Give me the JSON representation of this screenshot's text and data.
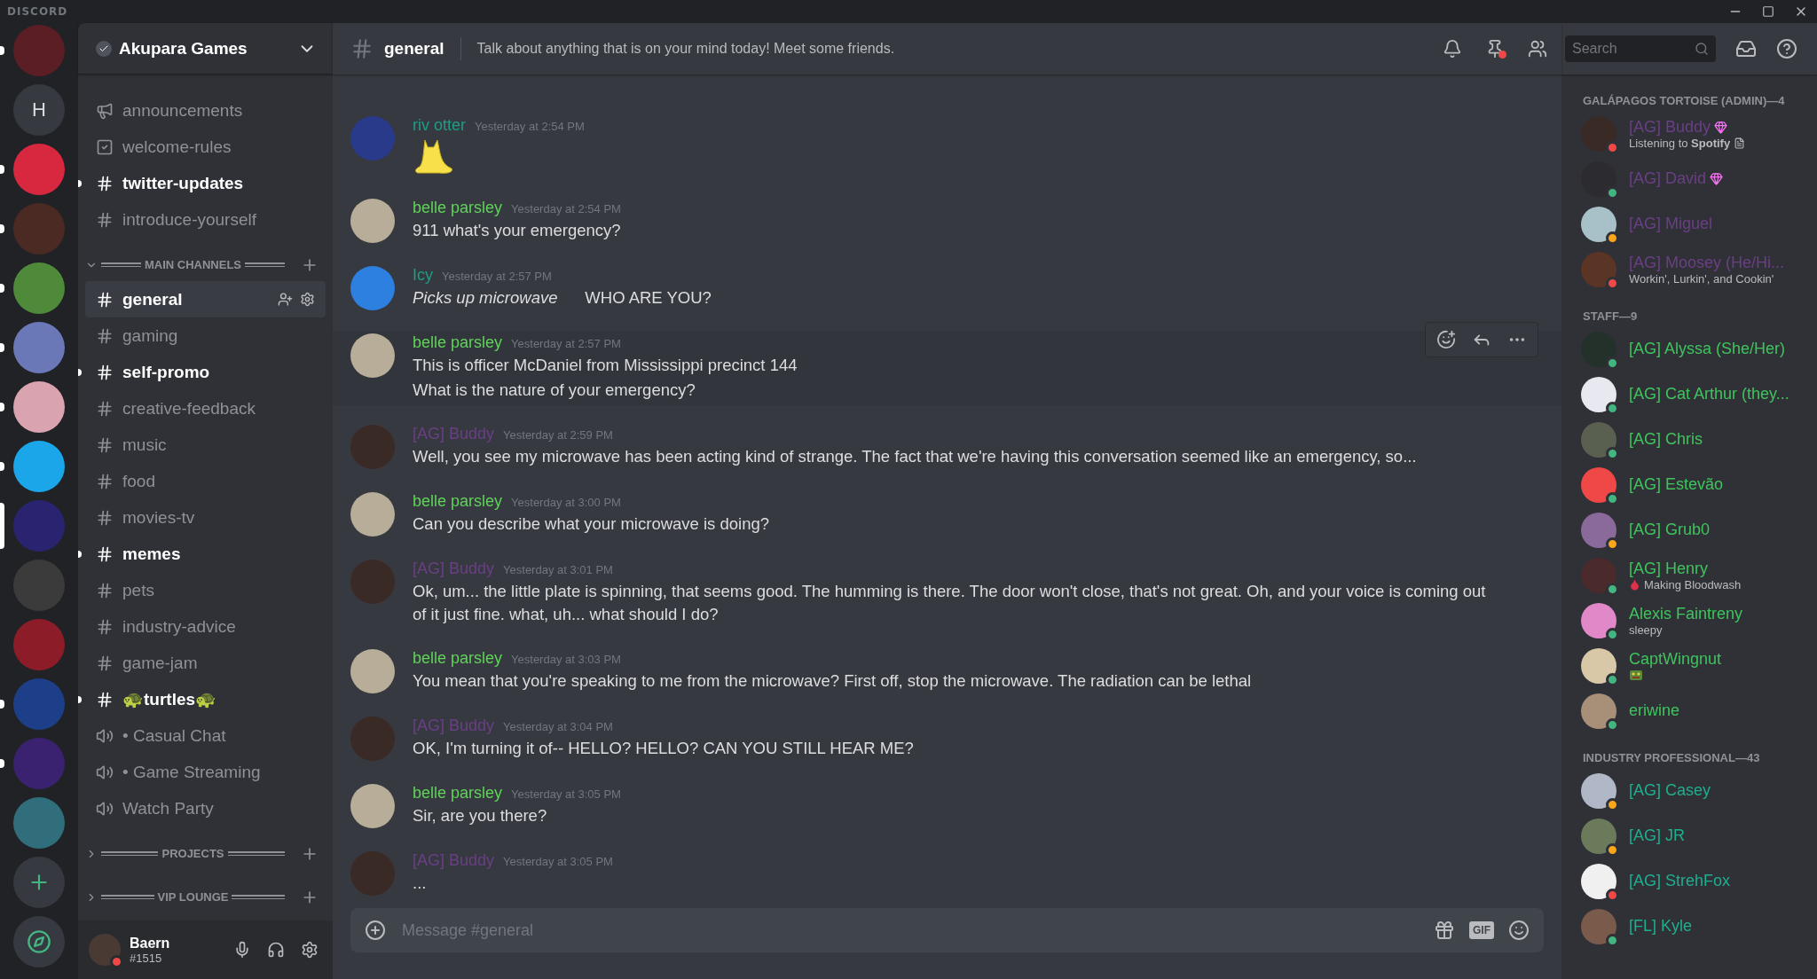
{
  "app": {
    "brand": "DISCORD"
  },
  "servers": [
    {
      "kind": "avatar",
      "color": "#5a1e24",
      "unread": true,
      "selected": false
    },
    {
      "kind": "letter",
      "label": "H",
      "unread": false,
      "selected": false
    },
    {
      "kind": "avatar",
      "color": "#d8283f",
      "unread": true,
      "selected": false
    },
    {
      "kind": "avatar",
      "color": "#4a2a22",
      "unread": true,
      "selected": false
    },
    {
      "kind": "avatar",
      "color": "#4f8a3a",
      "unread": true,
      "selected": false
    },
    {
      "kind": "avatar",
      "color": "#6a78b8",
      "unread": true,
      "selected": false
    },
    {
      "kind": "avatar",
      "color": "#d9a3b0",
      "unread": true,
      "selected": false
    },
    {
      "kind": "avatar",
      "color": "#1aa6e8",
      "unread": true,
      "selected": false
    },
    {
      "kind": "avatar",
      "color": "#2a2370",
      "unread": false,
      "selected": true
    },
    {
      "kind": "avatar",
      "color": "#3b3b3b",
      "unread": false,
      "selected": false
    },
    {
      "kind": "avatar",
      "color": "#8c1c28",
      "unread": false,
      "selected": false
    },
    {
      "kind": "avatar",
      "color": "#1d3f8a",
      "unread": true,
      "selected": false
    },
    {
      "kind": "avatar",
      "color": "#3a2270",
      "unread": true,
      "selected": false
    },
    {
      "kind": "avatar",
      "color": "#2f6e7a",
      "unread": false,
      "selected": false
    },
    {
      "kind": "add"
    },
    {
      "kind": "explore"
    }
  ],
  "guild": {
    "name": "Akupara Games",
    "verified": true
  },
  "channels": [
    {
      "kind": "announcement",
      "name": "announcements",
      "unread": false,
      "selected": false
    },
    {
      "kind": "rules",
      "name": "welcome-rules",
      "unread": false,
      "selected": false
    },
    {
      "kind": "text",
      "name": "twitter-updates",
      "unread": true,
      "selected": false
    },
    {
      "kind": "text",
      "name": "introduce-yourself",
      "unread": false,
      "selected": false
    },
    {
      "kind": "category",
      "name": "MAIN CHANNELS",
      "expanded": true,
      "children": [
        {
          "kind": "text",
          "name": "general",
          "unread": false,
          "selected": true
        },
        {
          "kind": "text",
          "name": "gaming",
          "unread": false,
          "selected": false
        },
        {
          "kind": "text",
          "name": "self-promo",
          "unread": true,
          "selected": false
        },
        {
          "kind": "text",
          "name": "creative-feedback",
          "unread": false,
          "selected": false
        },
        {
          "kind": "text",
          "name": "music",
          "unread": false,
          "selected": false
        },
        {
          "kind": "text",
          "name": "food",
          "unread": false,
          "selected": false
        },
        {
          "kind": "text",
          "name": "movies-tv",
          "unread": false,
          "selected": false
        },
        {
          "kind": "text",
          "name": "memes",
          "unread": true,
          "selected": false
        },
        {
          "kind": "text",
          "name": "pets",
          "unread": false,
          "selected": false
        },
        {
          "kind": "text",
          "name": "industry-advice",
          "unread": false,
          "selected": false
        },
        {
          "kind": "text",
          "name": "game-jam",
          "unread": false,
          "selected": false
        },
        {
          "kind": "text",
          "name": "🐢turtles🐢",
          "unread": true,
          "selected": false
        },
        {
          "kind": "voice",
          "name": "• Casual Chat",
          "unread": false,
          "selected": false
        },
        {
          "kind": "voice",
          "name": "• Game Streaming",
          "unread": false,
          "selected": false
        },
        {
          "kind": "voice",
          "name": "Watch Party",
          "unread": false,
          "selected": false
        }
      ]
    },
    {
      "kind": "category",
      "name": "PROJECTS",
      "expanded": false
    },
    {
      "kind": "category",
      "name": "VIP LOUNGE",
      "expanded": false
    }
  ],
  "user": {
    "name": "Baern",
    "tag": "#1515",
    "status": {
      "color": "#f04747"
    }
  },
  "header": {
    "channel": "general",
    "topic": "Talk about anything that is on your mind today! Meet some friends.",
    "search_placeholder": "Search"
  },
  "messages": [
    {
      "kind": "sticker",
      "author": "riv otter",
      "color": "#1f9c84",
      "avatar": {
        "color": "#2a3a8a"
      },
      "time": "Yesterday at 2:54 PM",
      "hovered": false
    },
    {
      "kind": "text",
      "author": "belle parsley",
      "color": "#5fd35a",
      "avatar": {
        "color": "#b8ad98"
      },
      "time": "Yesterday at 2:54 PM",
      "lines": [
        "911 what's your emergency?"
      ],
      "hovered": false
    },
    {
      "kind": "text",
      "author": "Icy",
      "color": "#1f9c84",
      "avatar": {
        "color": "#2d7fe0"
      },
      "time": "Yesterday at 2:57 PM",
      "lines": [
        "*Picks up microwave*      WHO ARE YOU?"
      ],
      "hovered": false
    },
    {
      "kind": "text",
      "author": "belle parsley",
      "color": "#5fd35a",
      "avatar": {
        "color": "#b8ad98"
      },
      "time": "Yesterday at 2:57 PM",
      "lines": [
        "This is officer McDaniel from Mississippi precinct 144",
        "What is the nature of your emergency?"
      ],
      "hovered": true
    },
    {
      "kind": "text",
      "author": "[AG] Buddy",
      "color": "#6a3f86",
      "avatar": {
        "color": "#3a2a26"
      },
      "time": "Yesterday at 2:59 PM",
      "lines": [
        "Well, you see my microwave has been acting kind of strange. The fact that we're having this conversation seemed like an emergency, so..."
      ],
      "hovered": false
    },
    {
      "kind": "text",
      "author": "belle parsley",
      "color": "#5fd35a",
      "avatar": {
        "color": "#b8ad98"
      },
      "time": "Yesterday at 3:00 PM",
      "lines": [
        "Can you describe what your microwave is doing?"
      ],
      "hovered": false
    },
    {
      "kind": "text",
      "author": "[AG] Buddy",
      "color": "#6a3f86",
      "avatar": {
        "color": "#3a2a26"
      },
      "time": "Yesterday at 3:01 PM",
      "lines": [
        "Ok, um... the little plate is spinning, that seems good. The humming is there. The door won't close, that's not great. Oh, and your voice is coming out of it just fine. what, uh... what should I do?"
      ],
      "hovered": false
    },
    {
      "kind": "text",
      "author": "belle parsley",
      "color": "#5fd35a",
      "avatar": {
        "color": "#b8ad98"
      },
      "time": "Yesterday at 3:03 PM",
      "lines": [
        "You mean that you're speaking to me from the microwave? First off, stop the microwave. The radiation can be lethal"
      ],
      "hovered": false
    },
    {
      "kind": "text",
      "author": "[AG] Buddy",
      "color": "#6a3f86",
      "avatar": {
        "color": "#3a2a26"
      },
      "time": "Yesterday at 3:04 PM",
      "lines": [
        "OK, I'm turning it of-- HELLO? HELLO? CAN YOU STILL HEAR ME?"
      ],
      "hovered": false
    },
    {
      "kind": "text",
      "author": "belle parsley",
      "color": "#5fd35a",
      "avatar": {
        "color": "#b8ad98"
      },
      "time": "Yesterday at 3:05 PM",
      "lines": [
        "Sir, are you there?"
      ],
      "hovered": false
    },
    {
      "kind": "text",
      "author": "[AG] Buddy",
      "color": "#6a3f86",
      "avatar": {
        "color": "#3a2a26"
      },
      "time": "Yesterday at 3:05 PM",
      "lines": [
        "..."
      ],
      "hovered": false
    }
  ],
  "composer": {
    "placeholder": "Message #general",
    "gif_label": "GIF"
  },
  "member_groups": [
    {
      "title": "GALÁPAGOS TORTOISE (ADMIN)—4",
      "members": [
        {
          "name": "[AG] Buddy",
          "color": "#6a3f86",
          "avatar": {
            "color": "#3a2a26"
          },
          "status": {
            "color": "#f04747"
          },
          "boost": true,
          "activity": "Listening to **Spotify**",
          "activity_icon": {
            "kind": "doc"
          }
        },
        {
          "name": "[AG] David",
          "color": "#6a3f86",
          "avatar": {
            "color": "#2c2c30"
          },
          "status": {
            "color": "#43b581"
          },
          "boost": true
        },
        {
          "name": "[AG] Miguel",
          "color": "#6a3f86",
          "avatar": {
            "color": "#a8c0c8"
          },
          "status": {
            "color": "#faa61a"
          },
          "boost": false
        },
        {
          "name": "[AG] Moosey (He/Hi...",
          "color": "#6a3f86",
          "avatar": {
            "color": "#5a3424"
          },
          "status": {
            "color": "#f04747"
          },
          "boost": false,
          "activity": "Workin', Lurkin', and Cookin'"
        }
      ]
    },
    {
      "title": "STAFF—9",
      "members": [
        {
          "name": "[AG] Alyssa (She/Her)",
          "color": "#3fc45d",
          "avatar": {
            "color": "#24302a"
          },
          "status": {
            "color": "#43b581"
          },
          "boost": false
        },
        {
          "name": "[AG] Cat Arthur (they...",
          "color": "#3fc45d",
          "avatar": {
            "color": "#e8e8f0"
          },
          "status": {
            "color": "#43b581"
          },
          "boost": false
        },
        {
          "name": "[AG] Chris",
          "color": "#3fc45d",
          "avatar": {
            "color": "#5a6050"
          },
          "status": {
            "color": "#43b581"
          },
          "boost": false
        },
        {
          "name": "[AG] Estevão",
          "color": "#3fc45d",
          "avatar": {
            "color": "#f04747"
          },
          "status": {
            "color": "#43b581"
          },
          "boost": false
        },
        {
          "name": "[AG] Grub0",
          "color": "#3fc45d",
          "avatar": {
            "color": "#8a6a9a"
          },
          "status": {
            "color": "#faa61a"
          },
          "boost": false
        },
        {
          "name": "[AG] Henry",
          "color": "#3fc45d",
          "avatar": {
            "color": "#4a2a2a"
          },
          "status": {
            "color": "#43b581"
          },
          "boost": false,
          "activity": "Making Bloodwash",
          "activity_icon": {
            "kind": "drop"
          }
        },
        {
          "name": "Alexis Faintreny",
          "color": "#3fc45d",
          "avatar": {
            "color": "#e088c8"
          },
          "status": {
            "color": "#43b581"
          },
          "boost": false,
          "activity": "sleepy"
        },
        {
          "name": "CaptWingnut",
          "color": "#3fc45d",
          "avatar": {
            "color": "#d8c8a8"
          },
          "status": {
            "color": "#43b581"
          },
          "boost": false,
          "activity_icon": {
            "kind": "emoji"
          }
        },
        {
          "name": "eriwine",
          "color": "#3fc45d",
          "avatar": {
            "color": "#a89078"
          },
          "status": {
            "color": "#43b581"
          },
          "boost": false
        }
      ]
    },
    {
      "title": "INDUSTRY PROFESSIONAL—43",
      "members": [
        {
          "name": "[AG] Casey",
          "color": "#1fae8e",
          "avatar": {
            "color": "#b0b8c8"
          },
          "status": {
            "color": "#faa61a"
          },
          "boost": false
        },
        {
          "name": "[AG] JR",
          "color": "#1fae8e",
          "avatar": {
            "color": "#6a7a5a"
          },
          "status": {
            "color": "#faa61a"
          },
          "boost": false
        },
        {
          "name": "[AG] StrehFox",
          "color": "#1fae8e",
          "avatar": {
            "color": "#f0f0f0"
          },
          "status": {
            "color": "#f04747"
          },
          "boost": false
        },
        {
          "name": "[FL] Kyle",
          "color": "#1fae8e",
          "avatar": {
            "color": "#7a5a4a"
          },
          "status": {
            "color": "#43b581"
          },
          "boost": false
        }
      ]
    }
  ]
}
